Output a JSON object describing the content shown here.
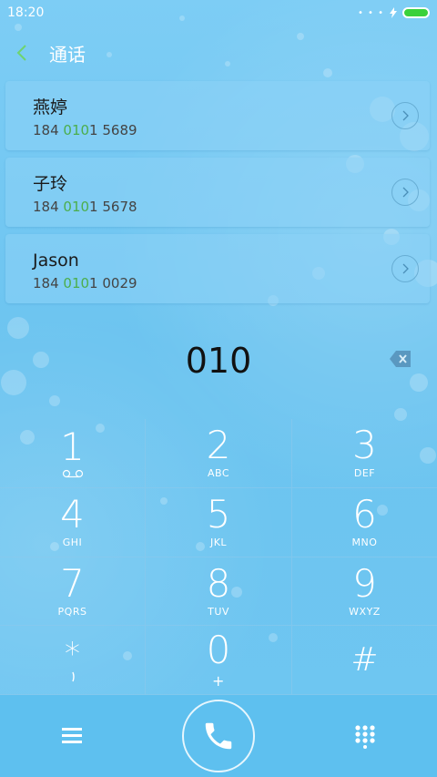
{
  "status_bar": {
    "time": "18:20",
    "signal_dots": "• • •"
  },
  "header": {
    "title": "通话"
  },
  "contacts": [
    {
      "name": "燕婷",
      "number_prefix": "184 ",
      "number_match": "010",
      "number_suffix": "1 5689"
    },
    {
      "name": "子玲",
      "number_prefix": "184 ",
      "number_match": "010",
      "number_suffix": "1 5678"
    },
    {
      "name": "Jason",
      "number_prefix": "184 ",
      "number_match": "010",
      "number_suffix": "1 0029"
    }
  ],
  "dialer": {
    "input_value": "010"
  },
  "keypad": [
    {
      "digit": "1",
      "sub": ""
    },
    {
      "digit": "2",
      "sub": "ABC"
    },
    {
      "digit": "3",
      "sub": "DEF"
    },
    {
      "digit": "4",
      "sub": "GHI"
    },
    {
      "digit": "5",
      "sub": "JKL"
    },
    {
      "digit": "6",
      "sub": "MNO"
    },
    {
      "digit": "7",
      "sub": "PQRS"
    },
    {
      "digit": "8",
      "sub": "TUV"
    },
    {
      "digit": "9",
      "sub": "WXYZ"
    },
    {
      "digit": "*",
      "sub": ""
    },
    {
      "digit": "0",
      "sub": "+"
    },
    {
      "digit": "#",
      "sub": ""
    }
  ],
  "colors": {
    "background": "#6cc5f0",
    "bottom_bar": "#5ec0ef",
    "match_highlight": "#4cae4c",
    "battery": "#3bd13b"
  },
  "icons": {
    "back": "chevron-left-icon",
    "detail": "chevron-right-icon",
    "backspace": "backspace-icon",
    "voicemail": "voicemail-icon",
    "pause": "pause-icon",
    "menu": "menu-icon",
    "call": "phone-icon",
    "dialpad": "dialpad-icon"
  }
}
